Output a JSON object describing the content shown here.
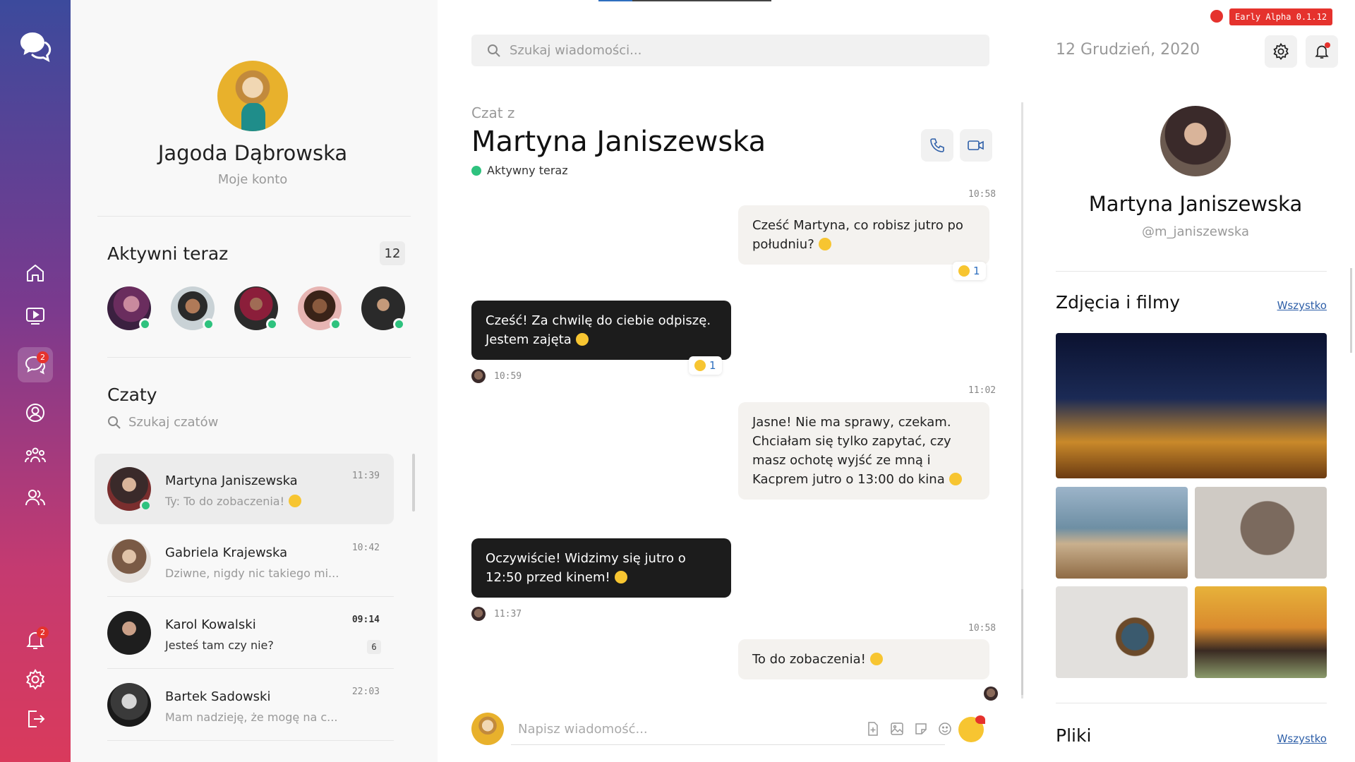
{
  "rail": {
    "logo_icon": "chat-bubbles-icon",
    "items": [
      {
        "name": "home",
        "icon": "home-icon"
      },
      {
        "name": "video",
        "icon": "video-icon"
      },
      {
        "name": "chats",
        "icon": "chat-icon",
        "badge": "2",
        "active": true
      },
      {
        "name": "profile",
        "icon": "user-icon"
      },
      {
        "name": "groups",
        "icon": "group-icon"
      },
      {
        "name": "friends",
        "icon": "friends-icon"
      }
    ],
    "bottom": [
      {
        "name": "notifications",
        "icon": "bell-icon",
        "badge": "2"
      },
      {
        "name": "settings",
        "icon": "gear-icon"
      },
      {
        "name": "logout",
        "icon": "logout-icon"
      }
    ]
  },
  "me": {
    "name": "Jagoda Dąbrowska",
    "subtitle": "Moje konto"
  },
  "active_now": {
    "title": "Aktywni teraz",
    "count": "12"
  },
  "chats": {
    "title": "Czaty",
    "search_placeholder": "Szukaj czatów",
    "items": [
      {
        "name": "Martyna Janiszewska",
        "preview": "Ty: To do zobaczenia!",
        "time": "11:39",
        "active": true,
        "online": true
      },
      {
        "name": "Gabriela Krajewska",
        "preview": "Dziwne, nigdy nic takiego mi...",
        "time": "10:42"
      },
      {
        "name": "Karol Kowalski",
        "preview": "Jesteś tam czy nie?",
        "time": "09:14",
        "unread": "6"
      },
      {
        "name": "Bartek Sadowski",
        "preview": "Mam nadzieję, że mogę na c...",
        "time": "22:03"
      }
    ]
  },
  "conversation": {
    "search_placeholder": "Szukaj wiadomości...",
    "label": "Czat z",
    "peer": "Martyna Janiszewska",
    "status": "Aktywny teraz",
    "messages": [
      {
        "dir": "out",
        "time": "10:58",
        "text": "Cześć Martyna, co robisz jutro po południu?",
        "reaction": "1"
      },
      {
        "dir": "in",
        "time": "10:59",
        "text": "Cześć! Za chwilę do ciebie odpiszę. Jestem zajęta",
        "reaction": "1"
      },
      {
        "dir": "out",
        "time": "11:02",
        "text": "Jasne! Nie ma sprawy, czekam. Chciałam się tylko zapytać, czy masz ochotę wyjść ze mną i Kacprem jutro o 13:00 do kina"
      },
      {
        "dir": "in",
        "time": "11:37",
        "text": "Oczywiście! Widzimy się jutro o 12:50 przed kinem!"
      },
      {
        "dir": "out",
        "time": "10:58",
        "text": "To do zobaczenia!"
      }
    ],
    "composer_placeholder": "Napisz wiadomość..."
  },
  "right": {
    "badge": "Early Alpha 0.1.12",
    "date": "12 Grudzień, 2020",
    "profile_name": "Martyna Janiszewska",
    "profile_handle": "@m_janiszewska",
    "media_title": "Zdjęcia i filmy",
    "media_all": "Wszystko",
    "files_title": "Pliki",
    "files_all": "Wszystko"
  },
  "colors": {
    "accent_red": "#e5322d",
    "online_green": "#2ec27e",
    "link_blue": "#2e5fa8",
    "dark_bubble": "#1c1c1c"
  }
}
